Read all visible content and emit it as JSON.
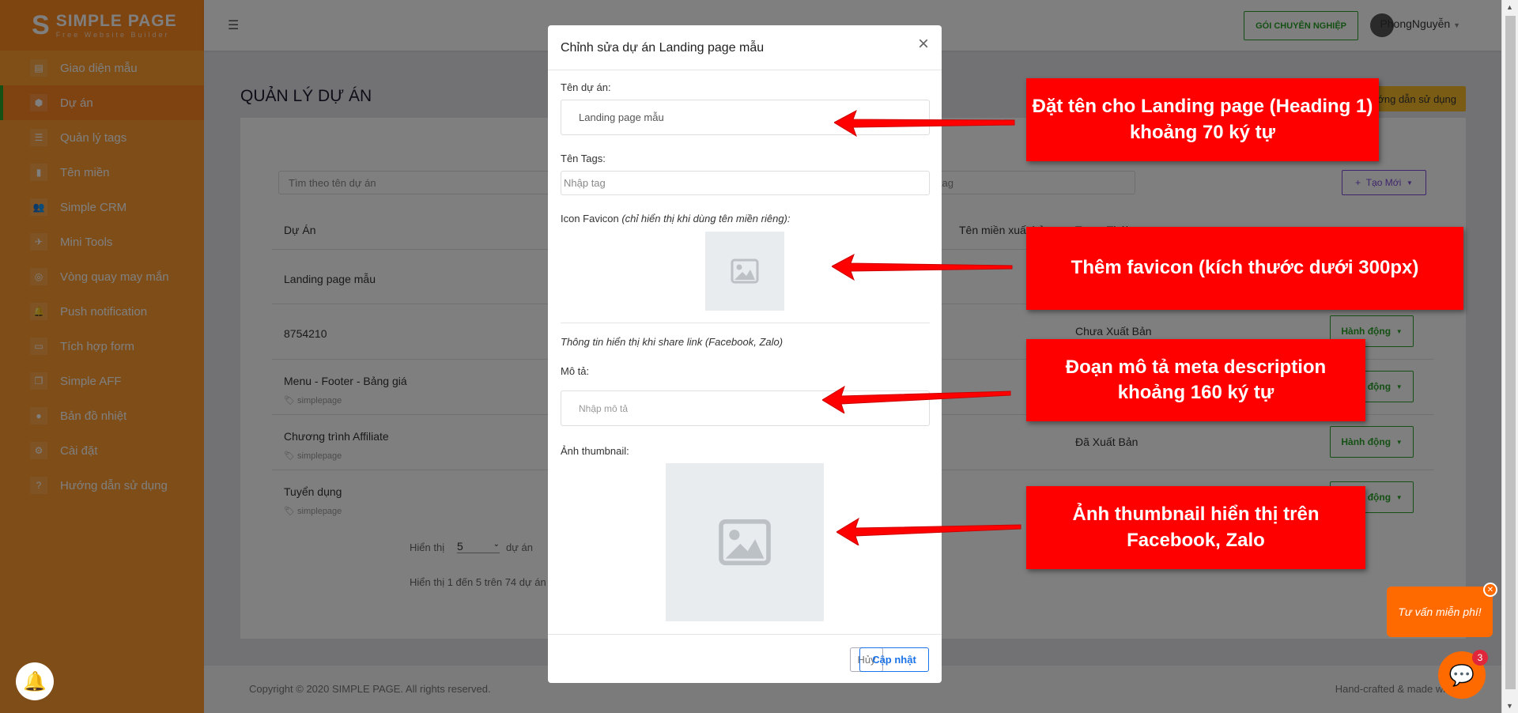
{
  "brand": {
    "name": "SIMPLE PAGE",
    "tagline": "Free Website Builder"
  },
  "sidebar": {
    "items": [
      {
        "label": "Giao diện mẫu",
        "icon": "template-icon"
      },
      {
        "label": "Dự án",
        "icon": "cube-icon",
        "active": true
      },
      {
        "label": "Quản lý tags",
        "icon": "list-icon"
      },
      {
        "label": "Tên miền",
        "icon": "bar-chart-icon"
      },
      {
        "label": "Simple CRM",
        "icon": "users-icon"
      },
      {
        "label": "Mini Tools",
        "icon": "rocket-icon"
      },
      {
        "label": "Vòng quay may mắn",
        "icon": "wheel-icon"
      },
      {
        "label": "Push notification",
        "icon": "bell-icon"
      },
      {
        "label": "Tích hợp form",
        "icon": "form-icon"
      },
      {
        "label": "Simple AFF",
        "icon": "copy-icon"
      },
      {
        "label": "Bản đồ nhiệt",
        "icon": "heatmap-icon"
      },
      {
        "label": "Cài đặt",
        "icon": "gear-icon"
      },
      {
        "label": "Hướng dẫn sử dụng",
        "icon": "help-icon"
      }
    ]
  },
  "header": {
    "pro_button": "GÓI CHUYÊN NGHIỆP",
    "username": "PhongNguyễn"
  },
  "main": {
    "title": "QUẢN LÝ DỰ ÁN",
    "guide_button": "Hướng dẫn sử dụng",
    "search_placeholder": "Tìm theo tên dự án",
    "tag_search_placeholder": "Tìm theo tag",
    "new_button": "Tạo Mới",
    "columns": [
      "Dự Án",
      "Tên miền xuất bản",
      "Trạng Thái"
    ],
    "rows": [
      {
        "name": "Landing page mẫu",
        "tag": "",
        "status": ""
      },
      {
        "name": "8754210",
        "tag": "",
        "status": "Chưa Xuất Bản"
      },
      {
        "name": "Menu - Footer - Bảng giá",
        "tag": "simplepage",
        "status": ""
      },
      {
        "name": "Chương trình Affiliate",
        "tag": "simplepage",
        "status": "Đã Xuất Bản"
      },
      {
        "name": "Tuyển dụng",
        "tag": "simplepage",
        "status": ""
      }
    ],
    "action_label": "Hành động",
    "pager": {
      "show_label": "Hiển thị",
      "page_size": "5",
      "unit": "dự án",
      "summary": "Hiển thị 1 đến 5 trên 74 dự án"
    }
  },
  "footer": {
    "copyright": "Copyright © 2020 SIMPLE PAGE. All rights reserved.",
    "credit": "Hand-crafted & made with"
  },
  "modal": {
    "title": "Chỉnh sửa dự án Landing page mẫu",
    "name_label": "Tên dự án:",
    "name_value": "Landing page mẫu",
    "tags_label": "Tên Tags:",
    "tags_placeholder": "Nhập tag",
    "favicon_label": "Icon Favicon",
    "favicon_note": "(chỉ hiển thị khi dùng tên miền riêng):",
    "share_info": "Thông tin hiển thị khi share link (Facebook, Zalo)",
    "desc_label": "Mô tả:",
    "desc_placeholder": "Nhập mô tả",
    "thumb_label": "Ảnh thumbnail:",
    "cancel": "Hủy",
    "save": "Cập nhật"
  },
  "annotations": [
    "Đặt tên cho Landing page (Heading 1) khoảng 70 ký tự",
    "Thêm favicon (kích thước dưới 300px)",
    "Đoạn mô tả meta description khoảng 160 ký tự",
    "Ảnh thumbnail hiển thị trên Facebook, Zalo"
  ],
  "chat": {
    "bubble": "Tư vấn miễn phí!",
    "badge": "3"
  },
  "colors": {
    "sidebar": "#fe9b30",
    "accent_green": "#2aa12a",
    "annotation": "#ff0000",
    "chat": "#ff6a00",
    "primary": "#1a73e8"
  }
}
